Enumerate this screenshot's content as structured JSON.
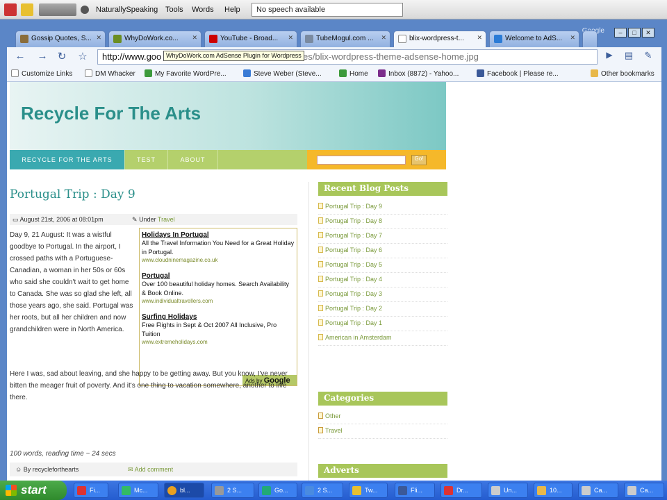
{
  "ns_bar": {
    "menus": [
      "NaturallySpeaking",
      "Tools",
      "Words",
      "Help"
    ],
    "status": "No speech available"
  },
  "browser": {
    "corner_label": "Google",
    "window_controls": [
      "–",
      "□",
      "✕"
    ],
    "tabs": [
      {
        "label": "Gossip Quotes, S...",
        "favicon": "gossip-icon",
        "color": "#8a6d3b"
      },
      {
        "label": "WhyDoWork.co...",
        "favicon": "whydowork-icon",
        "color": "#6b8e23"
      },
      {
        "label": "YouTube - Broad...",
        "favicon": "youtube-icon",
        "color": "#cc0000"
      },
      {
        "label": "TubeMogul.com ...",
        "favicon": "tubemogul-icon",
        "color": "#7a8aa0"
      },
      {
        "label": "blix-wordpress-t...",
        "favicon": "page-icon",
        "color": "#ffffff"
      },
      {
        "label": "Welcome to AdS...",
        "favicon": "adsense-icon",
        "color": "#2b7bd6"
      }
    ],
    "url_host": "http://www.goo",
    "url_rest": "s-themes/blix-wordpress-theme-adsense-home.jpg",
    "tooltip": "WhyDoWork.com AdSense Plugin for Wordpress",
    "bookmarks": [
      {
        "label": "Customize Links",
        "color": "#ffffff"
      },
      {
        "label": "DM Whacker",
        "color": "#ffffff"
      },
      {
        "label": "My Favorite WordPre...",
        "color": "#3c9a3c"
      },
      {
        "label": "Steve Weber (Steve...",
        "color": "#3a7bd5"
      },
      {
        "label": "Home",
        "color": "#3c9a3c"
      },
      {
        "label": "Inbox (8872) - Yahoo...",
        "color": "#7b2d8b"
      },
      {
        "label": "Facebook | Please re...",
        "color": "#3b5998"
      },
      {
        "label": "Other bookmarks",
        "color": "#e8b84a"
      }
    ]
  },
  "site": {
    "title": "Recycle For The Arts",
    "nav": [
      "RECYCLE FOR THE ARTS",
      "TEST",
      "ABOUT"
    ],
    "search_button": "Go!",
    "post": {
      "title": "Portugal Trip : Day 9",
      "date": "August 21st, 2006 at 08:01pm",
      "under_label": "Under",
      "category": "Travel",
      "body_p1": "Day 9, 21 August: It was a wistful goodbye to Portugal. In the airport, I crossed paths with a Portuguese-Canadian, a woman in her 50s or 60s who said she couldn't wait to get home to Canada. She was so glad she left, all those years ago, she said. Portugal was her roots, but all her children and now grandchildren were in North America.",
      "body_p2": "Here I was, sad about leaving, and she happy to be getting away. But you know, I've never bitten the meager fruit of poverty. And it's one thing to vacation somewhere, another to live there.",
      "word_count": "100 words, reading time ~ 24 secs",
      "author": "By recycleforthearts",
      "add_comment": "Add comment"
    },
    "ads": [
      {
        "title": "Holidays In Portugal",
        "desc": "All the Travel Information You Need for a Great Holiday in Portugal.",
        "url": "www.cloudninemagazine.co.uk"
      },
      {
        "title": "Portugal",
        "desc": "Over 100 beautiful holiday homes. Search Availability & Book Online.",
        "url": "www.individualtravellers.com"
      },
      {
        "title": "Surfing Holidays",
        "desc": "Free Flights in Sept & Oct 2007 All Inclusive, Pro Tuition",
        "url": "www.extremeholidays.com"
      }
    ],
    "ads_by": "Ads by",
    "ads_brand": "Google",
    "sidebar": {
      "recent_heading": "Recent Blog Posts",
      "recent": [
        "Portugal Trip : Day 9",
        "Portugal Trip : Day 8",
        "Portugal Trip : Day 7",
        "Portugal Trip : Day 6",
        "Portugal Trip : Day 5",
        "Portugal Trip : Day 4",
        "Portugal Trip : Day 3",
        "Portugal Trip : Day 2",
        "Portugal Trip : Day 1",
        "American in Amsterdam"
      ],
      "categories_heading": "Categories",
      "categories": [
        "Other",
        "Travel"
      ],
      "adverts_heading": "Adverts"
    }
  },
  "taskbar": {
    "start": "start",
    "tasks": [
      {
        "label": "Fi...",
        "color": "#d33"
      },
      {
        "label": "Mc...",
        "color": "#3b6"
      },
      {
        "label": "bl...",
        "color": "#e8a020"
      },
      {
        "label": "2 S...",
        "color": "#999"
      },
      {
        "label": "Go...",
        "color": "#2a7"
      },
      {
        "label": "2 S...",
        "color": "#4a8be0"
      },
      {
        "label": "Tw...",
        "color": "#e8c030"
      },
      {
        "label": "Fli...",
        "color": "#3b5998"
      },
      {
        "label": "Dr...",
        "color": "#d33"
      },
      {
        "label": "Un...",
        "color": "#ccc"
      },
      {
        "label": "10...",
        "color": "#e8b84a"
      },
      {
        "label": "Ca...",
        "color": "#ccc"
      },
      {
        "label": "Ca...",
        "color": "#ccc"
      }
    ]
  }
}
